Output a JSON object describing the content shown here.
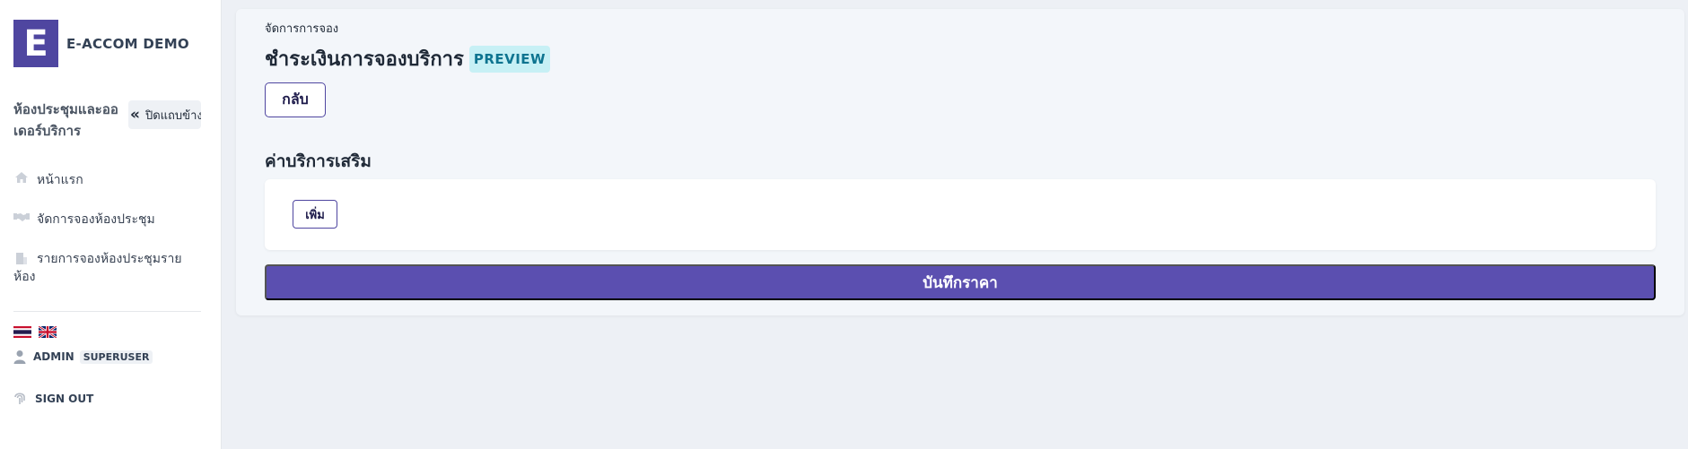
{
  "sidebar": {
    "logo_letter": "E",
    "brand_name": "E-ACCOM DEMO",
    "section_title": "ห้องประชุมและออเดอร์บริการ",
    "collapse_chevron": "«",
    "collapse_label": "ปิดแถบข้าง",
    "nav": [
      {
        "label": "หน้าแรก",
        "icon": "home-icon"
      },
      {
        "label": "จัดการจองห้องประชุม",
        "icon": "handshake-icon"
      },
      {
        "label": "รายการจองห้องประชุมรายห้อง",
        "icon": "building-icon"
      }
    ],
    "languages": [
      "thai-flag-icon",
      "uk-flag-icon"
    ],
    "user": {
      "name": "ADMIN",
      "role": "SUPERUSER"
    },
    "signout_label": "SIGN OUT"
  },
  "main": {
    "breadcrumb": "จัดการการจอง",
    "title": "ชำระเงินการจองบริการ",
    "preview_badge": "PREVIEW",
    "back_label": "กลับ",
    "section_title": "ค่าบริการเสริม",
    "add_label": "เพิ่ม",
    "save_label": "บันทึกราคา"
  },
  "colors": {
    "accent": "#5b4fb0",
    "logo": "#4f46a0",
    "preview_bg": "#c7f0f5",
    "preview_text": "#0e7490",
    "page_bg": "#edf0f5"
  }
}
